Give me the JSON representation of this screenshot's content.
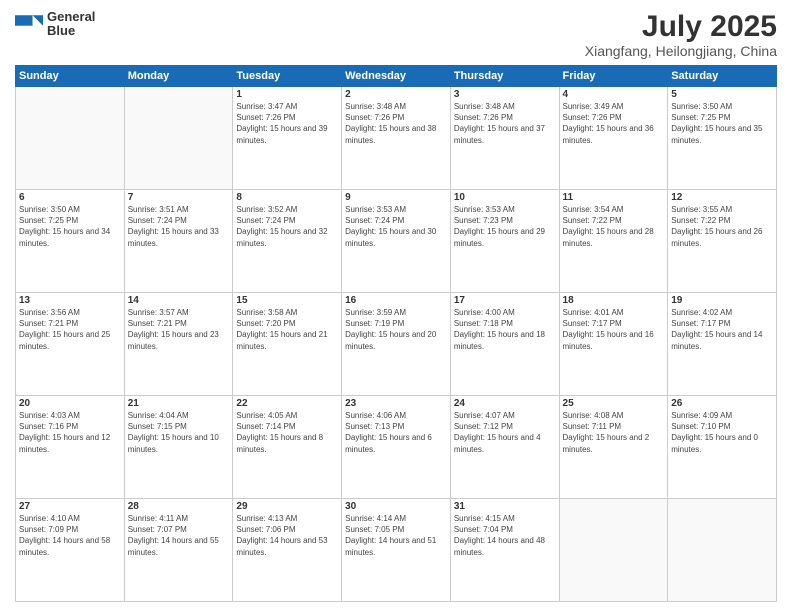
{
  "header": {
    "logo_line1": "General",
    "logo_line2": "Blue",
    "month": "July 2025",
    "location": "Xiangfang, Heilongjiang, China"
  },
  "days_of_week": [
    "Sunday",
    "Monday",
    "Tuesday",
    "Wednesday",
    "Thursday",
    "Friday",
    "Saturday"
  ],
  "weeks": [
    [
      {
        "day": "",
        "empty": true
      },
      {
        "day": "",
        "empty": true
      },
      {
        "day": "1",
        "sunrise": "3:47 AM",
        "sunset": "7:26 PM",
        "daylight": "15 hours and 39 minutes."
      },
      {
        "day": "2",
        "sunrise": "3:48 AM",
        "sunset": "7:26 PM",
        "daylight": "15 hours and 38 minutes."
      },
      {
        "day": "3",
        "sunrise": "3:48 AM",
        "sunset": "7:26 PM",
        "daylight": "15 hours and 37 minutes."
      },
      {
        "day": "4",
        "sunrise": "3:49 AM",
        "sunset": "7:26 PM",
        "daylight": "15 hours and 36 minutes."
      },
      {
        "day": "5",
        "sunrise": "3:50 AM",
        "sunset": "7:25 PM",
        "daylight": "15 hours and 35 minutes."
      }
    ],
    [
      {
        "day": "6",
        "sunrise": "3:50 AM",
        "sunset": "7:25 PM",
        "daylight": "15 hours and 34 minutes."
      },
      {
        "day": "7",
        "sunrise": "3:51 AM",
        "sunset": "7:24 PM",
        "daylight": "15 hours and 33 minutes."
      },
      {
        "day": "8",
        "sunrise": "3:52 AM",
        "sunset": "7:24 PM",
        "daylight": "15 hours and 32 minutes."
      },
      {
        "day": "9",
        "sunrise": "3:53 AM",
        "sunset": "7:24 PM",
        "daylight": "15 hours and 30 minutes."
      },
      {
        "day": "10",
        "sunrise": "3:53 AM",
        "sunset": "7:23 PM",
        "daylight": "15 hours and 29 minutes."
      },
      {
        "day": "11",
        "sunrise": "3:54 AM",
        "sunset": "7:22 PM",
        "daylight": "15 hours and 28 minutes."
      },
      {
        "day": "12",
        "sunrise": "3:55 AM",
        "sunset": "7:22 PM",
        "daylight": "15 hours and 26 minutes."
      }
    ],
    [
      {
        "day": "13",
        "sunrise": "3:56 AM",
        "sunset": "7:21 PM",
        "daylight": "15 hours and 25 minutes."
      },
      {
        "day": "14",
        "sunrise": "3:57 AM",
        "sunset": "7:21 PM",
        "daylight": "15 hours and 23 minutes."
      },
      {
        "day": "15",
        "sunrise": "3:58 AM",
        "sunset": "7:20 PM",
        "daylight": "15 hours and 21 minutes."
      },
      {
        "day": "16",
        "sunrise": "3:59 AM",
        "sunset": "7:19 PM",
        "daylight": "15 hours and 20 minutes."
      },
      {
        "day": "17",
        "sunrise": "4:00 AM",
        "sunset": "7:18 PM",
        "daylight": "15 hours and 18 minutes."
      },
      {
        "day": "18",
        "sunrise": "4:01 AM",
        "sunset": "7:17 PM",
        "daylight": "15 hours and 16 minutes."
      },
      {
        "day": "19",
        "sunrise": "4:02 AM",
        "sunset": "7:17 PM",
        "daylight": "15 hours and 14 minutes."
      }
    ],
    [
      {
        "day": "20",
        "sunrise": "4:03 AM",
        "sunset": "7:16 PM",
        "daylight": "15 hours and 12 minutes."
      },
      {
        "day": "21",
        "sunrise": "4:04 AM",
        "sunset": "7:15 PM",
        "daylight": "15 hours and 10 minutes."
      },
      {
        "day": "22",
        "sunrise": "4:05 AM",
        "sunset": "7:14 PM",
        "daylight": "15 hours and 8 minutes."
      },
      {
        "day": "23",
        "sunrise": "4:06 AM",
        "sunset": "7:13 PM",
        "daylight": "15 hours and 6 minutes."
      },
      {
        "day": "24",
        "sunrise": "4:07 AM",
        "sunset": "7:12 PM",
        "daylight": "15 hours and 4 minutes."
      },
      {
        "day": "25",
        "sunrise": "4:08 AM",
        "sunset": "7:11 PM",
        "daylight": "15 hours and 2 minutes."
      },
      {
        "day": "26",
        "sunrise": "4:09 AM",
        "sunset": "7:10 PM",
        "daylight": "15 hours and 0 minutes."
      }
    ],
    [
      {
        "day": "27",
        "sunrise": "4:10 AM",
        "sunset": "7:09 PM",
        "daylight": "14 hours and 58 minutes."
      },
      {
        "day": "28",
        "sunrise": "4:11 AM",
        "sunset": "7:07 PM",
        "daylight": "14 hours and 55 minutes."
      },
      {
        "day": "29",
        "sunrise": "4:13 AM",
        "sunset": "7:06 PM",
        "daylight": "14 hours and 53 minutes."
      },
      {
        "day": "30",
        "sunrise": "4:14 AM",
        "sunset": "7:05 PM",
        "daylight": "14 hours and 51 minutes."
      },
      {
        "day": "31",
        "sunrise": "4:15 AM",
        "sunset": "7:04 PM",
        "daylight": "14 hours and 48 minutes."
      },
      {
        "day": "",
        "empty": true
      },
      {
        "day": "",
        "empty": true
      }
    ]
  ]
}
